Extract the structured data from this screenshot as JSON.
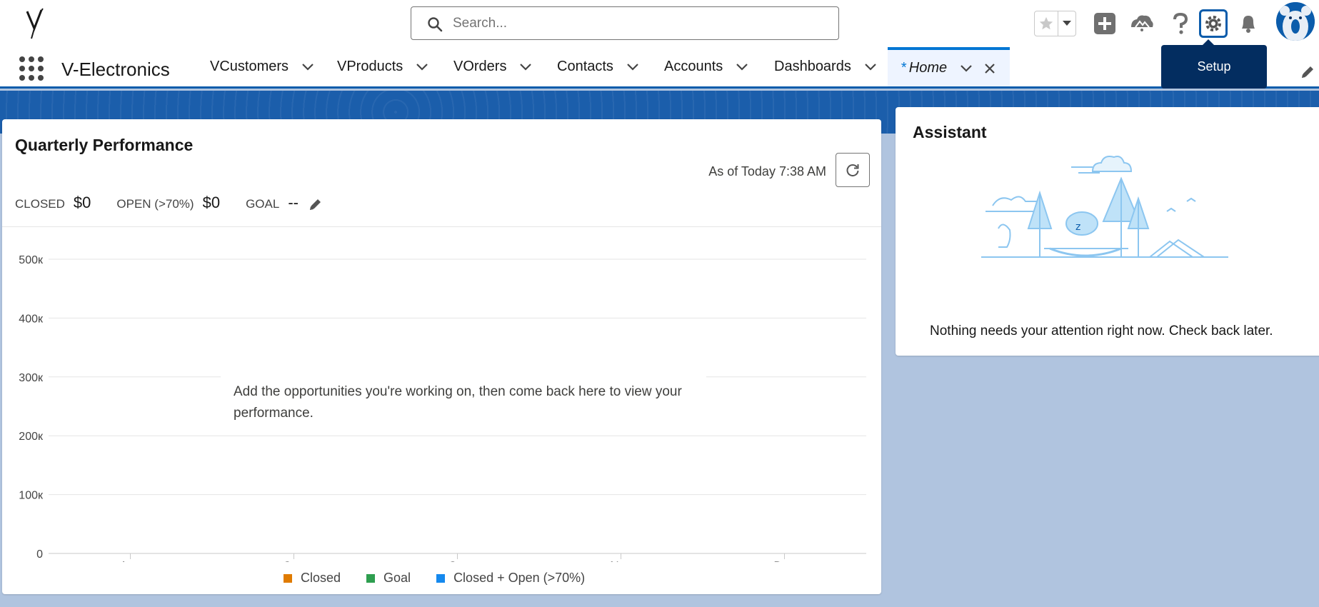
{
  "header": {
    "search_placeholder": "Search...",
    "tooltip": "Setup",
    "icons": [
      "favorites-star-icon",
      "add-icon",
      "trailhead-icon",
      "help-icon",
      "setup-gear-icon",
      "notifications-bell-icon"
    ]
  },
  "nav": {
    "app_name": "V-Electronics",
    "items": [
      {
        "label": "VCustomers"
      },
      {
        "label": "VProducts"
      },
      {
        "label": "VOrders"
      },
      {
        "label": "Contacts"
      },
      {
        "label": "Accounts"
      },
      {
        "label": "Dashboards"
      }
    ],
    "active_tab": {
      "prefix": "*",
      "label": "Home"
    }
  },
  "performance": {
    "title": "Quarterly Performance",
    "as_of": "As of Today 7:38 AM",
    "closed_label": "CLOSED",
    "closed_value": "$0",
    "open_label": "OPEN (>70%)",
    "open_value": "$0",
    "goal_label": "GOAL",
    "goal_value": "--",
    "empty_message": "Add the opportunities you're working on, then come back here to view your performance."
  },
  "chart_data": {
    "type": "line",
    "categories": [
      "Aug",
      "Sep",
      "Oct",
      "Nov",
      "Dec"
    ],
    "y_ticks": [
      "0",
      "100к",
      "200к",
      "300к",
      "400к",
      "500к"
    ],
    "ylim": [
      0,
      500000
    ],
    "series": [
      {
        "name": "Closed",
        "color": "#e07b00",
        "values": []
      },
      {
        "name": "Goal",
        "color": "#2e9e4f",
        "values": []
      },
      {
        "name": "Closed + Open (>70%)",
        "color": "#1589ee",
        "values": []
      }
    ],
    "grid": true,
    "legend": "bottom"
  },
  "assistant": {
    "title": "Assistant",
    "message": "Nothing needs your attention right now. Check back later."
  }
}
